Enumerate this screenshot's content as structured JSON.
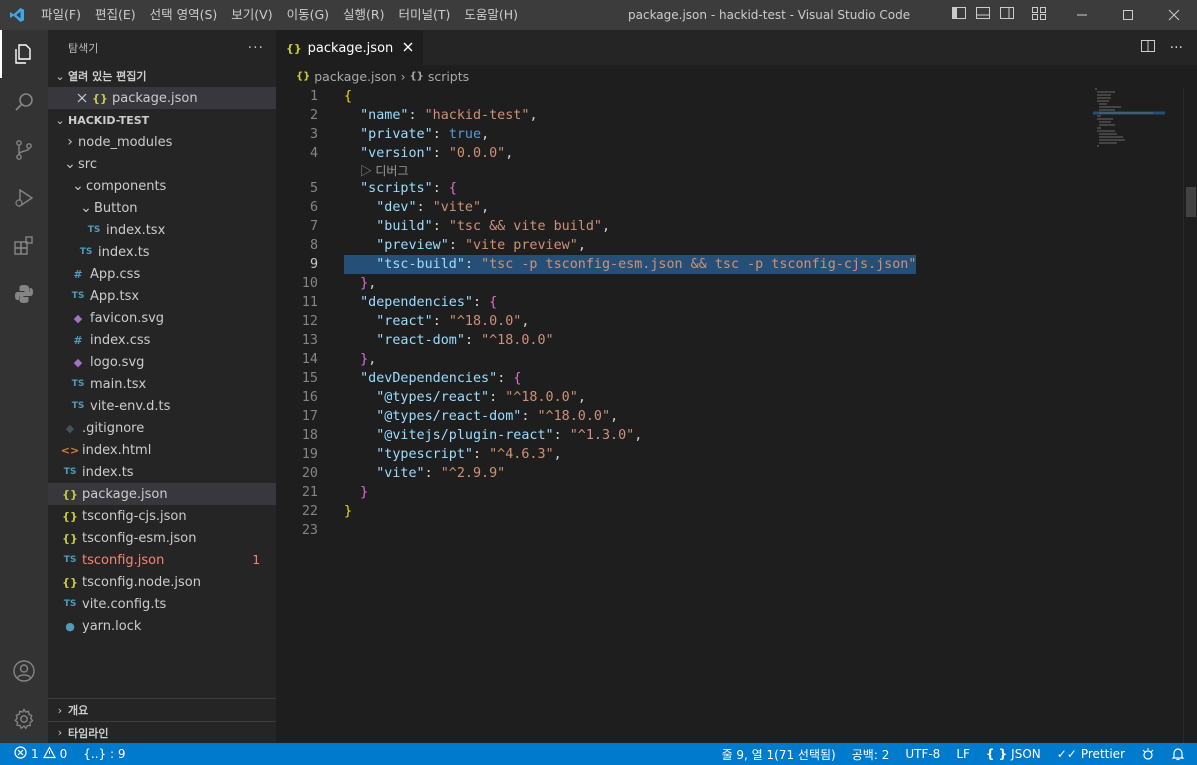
{
  "window": {
    "title": "package.json - hackid-test - Visual Studio Code",
    "accent": "#007acc"
  },
  "menu": [
    "파일(F)",
    "편집(E)",
    "선택 영역(S)",
    "보기(V)",
    "이동(G)",
    "실행(R)",
    "터미널(T)",
    "도움말(H)"
  ],
  "sidebar": {
    "title": "탐색기",
    "more": "···",
    "open_editors": {
      "title": "열려 있는 편집기",
      "items": [
        {
          "icon": "{}",
          "label": "package.json"
        }
      ]
    },
    "project": {
      "title": "HACKID-TEST",
      "items": [
        {
          "label": "node_modules",
          "type": "folder",
          "expanded": false,
          "depth": 0
        },
        {
          "label": "src",
          "type": "folder",
          "expanded": true,
          "depth": 0
        },
        {
          "label": "components",
          "type": "folder",
          "expanded": true,
          "depth": 1
        },
        {
          "label": "Button",
          "type": "folder",
          "expanded": true,
          "depth": 2
        },
        {
          "label": "index.tsx",
          "type": "ts",
          "depth": 3
        },
        {
          "label": "index.ts",
          "type": "ts",
          "depth": 2
        },
        {
          "label": "App.css",
          "type": "css",
          "depth": 1
        },
        {
          "label": "App.tsx",
          "type": "ts",
          "depth": 1
        },
        {
          "label": "favicon.svg",
          "type": "svg",
          "depth": 1
        },
        {
          "label": "index.css",
          "type": "css",
          "depth": 1
        },
        {
          "label": "logo.svg",
          "type": "svg",
          "depth": 1
        },
        {
          "label": "main.tsx",
          "type": "ts",
          "depth": 1
        },
        {
          "label": "vite-env.d.ts",
          "type": "ts",
          "depth": 1
        },
        {
          "label": ".gitignore",
          "type": "git",
          "depth": 0
        },
        {
          "label": "index.html",
          "type": "html",
          "depth": 0
        },
        {
          "label": "index.ts",
          "type": "ts",
          "depth": 0
        },
        {
          "label": "package.json",
          "type": "json",
          "depth": 0,
          "selected": true
        },
        {
          "label": "tsconfig-cjs.json",
          "type": "json",
          "depth": 0
        },
        {
          "label": "tsconfig-esm.json",
          "type": "json",
          "depth": 0
        },
        {
          "label": "tsconfig.json",
          "type": "tsconfig",
          "depth": 0,
          "error": true,
          "badge": "1"
        },
        {
          "label": "tsconfig.node.json",
          "type": "json",
          "depth": 0
        },
        {
          "label": "vite.config.ts",
          "type": "ts",
          "depth": 0
        },
        {
          "label": "yarn.lock",
          "type": "yarn",
          "depth": 0
        }
      ]
    },
    "outline": "개요",
    "timeline": "타임라인"
  },
  "editor": {
    "tab_label": "package.json",
    "breadcrumb": [
      "package.json",
      "scripts"
    ],
    "codelens": "디버그",
    "current_line": 9
  },
  "status": {
    "errors": "1",
    "warnings": "0",
    "brackets": "{..} : 9",
    "position": "줄 9, 열 1(71 선택됨)",
    "spaces": "공백: 2",
    "encoding": "UTF-8",
    "eol": "LF",
    "language": "JSON",
    "prettier": "Prettier"
  }
}
